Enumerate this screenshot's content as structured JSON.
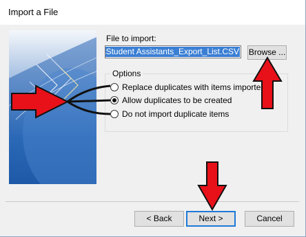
{
  "window": {
    "title": "Import a File"
  },
  "file": {
    "label": "File to import:",
    "path": "ip\\Student Assistants_Export_List.CSV",
    "browse_label": "Browse ..."
  },
  "options": {
    "legend": "Options",
    "items": [
      {
        "label": "Replace duplicates with items imported",
        "selected": false
      },
      {
        "label": "Allow duplicates to be created",
        "selected": true
      },
      {
        "label": "Do not import duplicate items",
        "selected": false
      }
    ]
  },
  "buttons": {
    "back": "< Back",
    "next": "Next >",
    "cancel": "Cancel"
  },
  "annotation": {
    "arrow_color": "#e8111a"
  }
}
